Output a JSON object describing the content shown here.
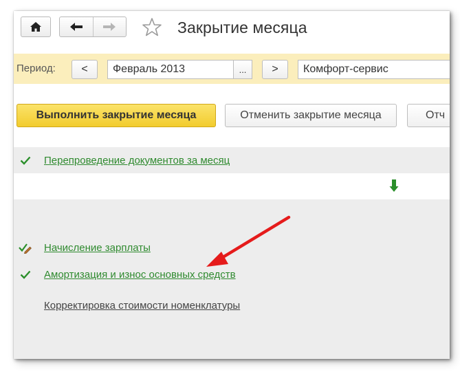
{
  "window": {
    "title": "Закрытие месяца",
    "icons": {
      "home": "home-icon",
      "back": "arrow-left-icon",
      "forward": "arrow-right-icon",
      "favorite": "star-icon"
    }
  },
  "period_bar": {
    "label": "Период:",
    "prev_label": "<",
    "next_label": ">",
    "period_value": "Февраль 2013",
    "choose_label": "...",
    "organization_value": "Комфорт-сервис",
    "background": "#fbeebc"
  },
  "actions": {
    "run_label": "Выполнить закрытие месяца",
    "cancel_label": "Отменить закрытие месяца",
    "third_label": "Отч"
  },
  "operations": [
    {
      "label": "Перепроведение документов за месяц",
      "status": "done",
      "icon": "checkmark-icon"
    },
    {
      "label": "Начисление зарплаты",
      "status": "done-with-warning",
      "icon": "checkmark-pencil-icon"
    },
    {
      "label": "Амортизация и износ основных средств",
      "status": "done",
      "icon": "checkmark-icon"
    },
    {
      "label": "Корректировка стоимости номенклатуры",
      "status": "pending",
      "icon": ""
    }
  ],
  "colors": {
    "accent_yellow": "#f2cc2e",
    "link_green": "#2f8a2f",
    "annotation_red": "#e51b1b"
  }
}
